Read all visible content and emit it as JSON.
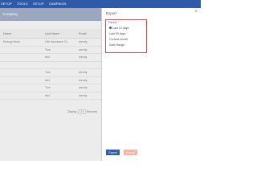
{
  "nav": {
    "items": [
      "SETUP",
      "TOOLS",
      "SETUP",
      "CAMPAIGN"
    ]
  },
  "main": {
    "subbar_title": "Company",
    "table": {
      "headers": [
        "Name",
        "Last Name",
        "Email"
      ],
      "rows": [
        [
          "Energy Bank",
          "Life Insurance Co",
          "wendy"
        ],
        [
          "",
          "Tom",
          "wendy"
        ],
        [
          "",
          "test",
          "wendy"
        ],
        [
          "",
          "",
          ""
        ],
        [
          "",
          "Tom",
          "wendy"
        ],
        [
          "",
          "test",
          "wendy"
        ],
        [
          "",
          "Tom",
          "wendy"
        ],
        [
          "",
          "test",
          "wendy"
        ]
      ]
    },
    "pager": {
      "display_label": "Display",
      "page_size": "100",
      "records_label": "Records"
    }
  },
  "panel": {
    "title": "Export",
    "close_icon": "close-icon",
    "period": {
      "label": "Period *",
      "options": [
        "Last 10 days",
        "Last 30 days",
        "Current month",
        "Date Range"
      ],
      "selected_index": 0
    },
    "buttons": {
      "export": "Export",
      "cancel": "Cancel"
    },
    "colors": {
      "highlight_border": "#e14a4a",
      "primary": "#2e5cad",
      "cancel": "#f1b5a9"
    }
  }
}
